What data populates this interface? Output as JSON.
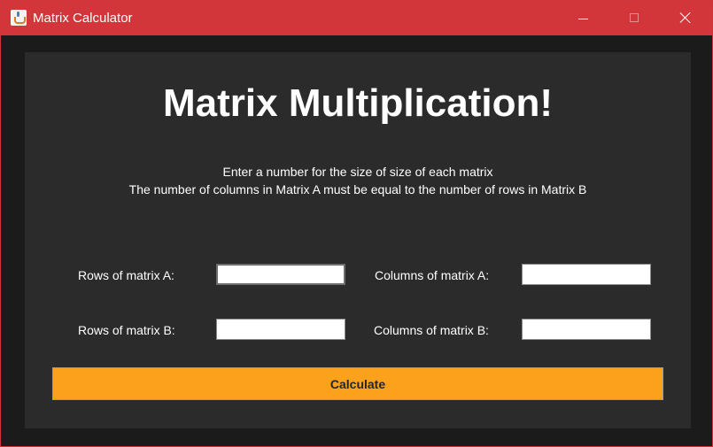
{
  "window": {
    "title": "Matrix Calculator",
    "icon": "java-cup-icon",
    "titlebar_color": "#d2363a",
    "controls": [
      "minimize-icon",
      "maximize-icon",
      "close-icon"
    ]
  },
  "main": {
    "heading": "Matrix Multiplication!",
    "instruction_line1": "Enter a number for the size of size of each matrix",
    "instruction_line2": "The number of columns in Matrix A must be equal to the number of rows in Matrix B",
    "panel_color": "#2b2b2b"
  },
  "form": {
    "rows_a_label": "Rows of matrix A:",
    "rows_a_value": "",
    "cols_a_label": "Columns of matrix A:",
    "cols_a_value": "",
    "rows_b_label": "Rows of matrix B:",
    "rows_b_value": "",
    "cols_b_label": "Columns of matrix B:",
    "cols_b_value": ""
  },
  "actions": {
    "calculate_label": "Calculate",
    "calculate_color": "#fca11c"
  }
}
